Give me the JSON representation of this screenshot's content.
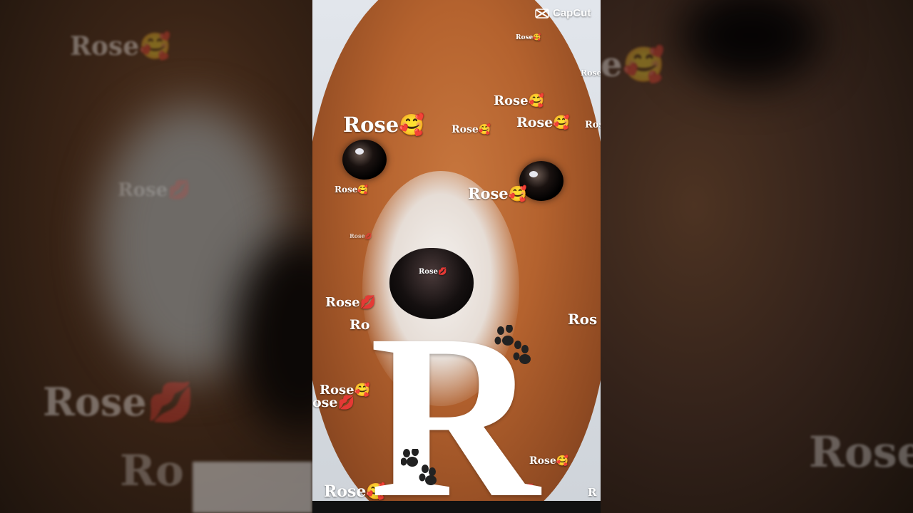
{
  "overlay_text": {
    "word": "Rose",
    "emoji_hug": "🥰",
    "emoji_kiss": "💋",
    "big_letter": "R"
  },
  "watermark": {
    "brand": "CapCut",
    "icon": "capcut-logo-icon"
  },
  "colors": {
    "fur": "#b4622e",
    "text": "#ffffff"
  }
}
